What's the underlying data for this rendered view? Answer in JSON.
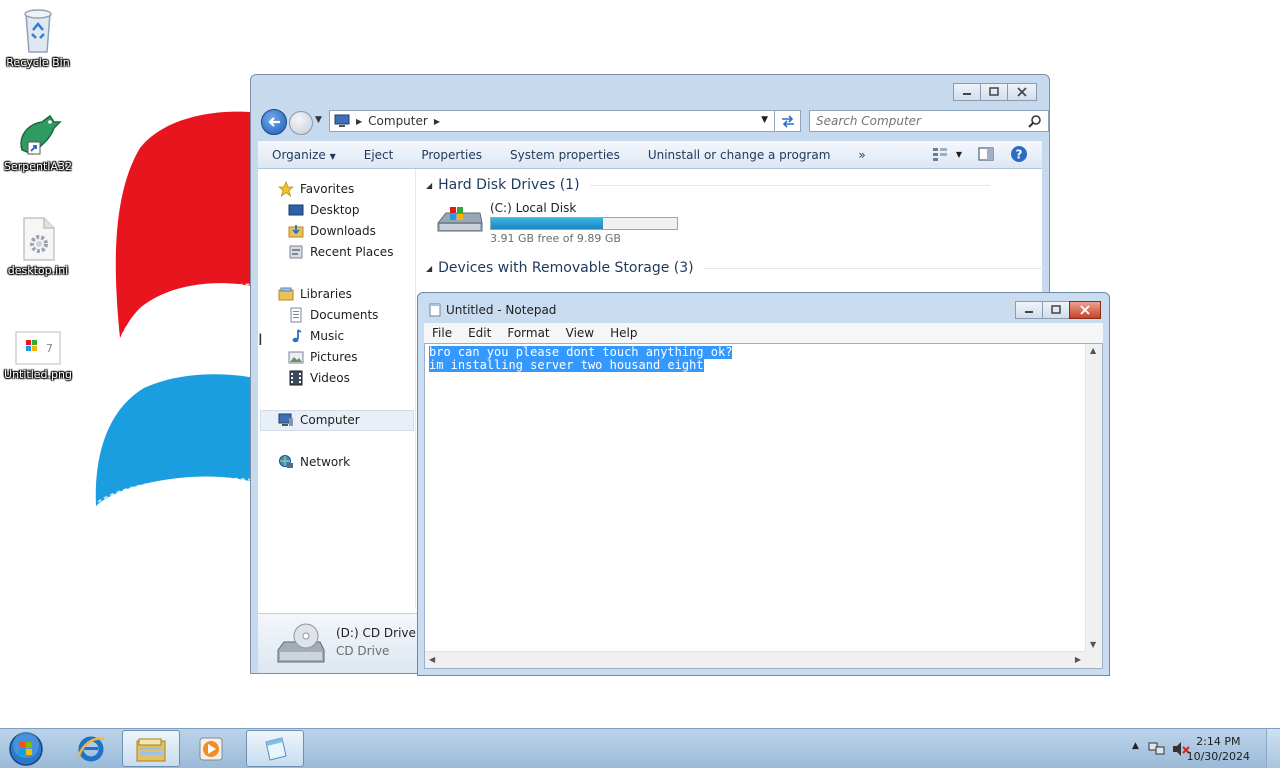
{
  "desktop": {
    "icons": [
      {
        "label": "Recycle Bin",
        "icon": "recycle-bin-icon"
      },
      {
        "label": "SerpentIA32",
        "icon": "serpent-dragon-icon"
      },
      {
        "label": "desktop.ini",
        "icon": "settings-file-icon"
      },
      {
        "label": "Untitled.png",
        "icon": "image-file-icon"
      }
    ]
  },
  "explorer": {
    "address": {
      "crumb": "Computer"
    },
    "search": {
      "placeholder": "Search Computer"
    },
    "toolbar": {
      "organize": "Organize",
      "eject": "Eject",
      "properties": "Properties",
      "system_properties": "System properties",
      "uninstall": "Uninstall or change a program",
      "more": "»"
    },
    "nav": {
      "favorites": "Favorites",
      "desktop": "Desktop",
      "downloads": "Downloads",
      "recent_places": "Recent Places",
      "libraries": "Libraries",
      "documents": "Documents",
      "music": "Music",
      "pictures": "Pictures",
      "videos": "Videos",
      "computer": "Computer",
      "network": "Network"
    },
    "groups": {
      "hard_disks": "Hard Disk Drives (1)",
      "removable": "Devices with Removable Storage (3)"
    },
    "drive_c": {
      "name": "(C:) Local Disk",
      "free_text": "3.91 GB free of 9.89 GB",
      "used_fraction": 0.6
    },
    "details": {
      "name": "(D:) CD Drive",
      "type": "CD Drive"
    }
  },
  "notepad": {
    "title": "Untitled - Notepad",
    "menu": {
      "file": "File",
      "edit": "Edit",
      "format": "Format",
      "view": "View",
      "help": "Help"
    },
    "lines": [
      "bro can you please dont touch anything ok?",
      "im installing server two housand eight"
    ]
  },
  "taskbar": {
    "time": "2:14 PM",
    "date": "10/30/2024"
  },
  "colors": {
    "selection": "#3399ff",
    "accent_red": "#e8141e",
    "accent_blue": "#1a9ee0"
  }
}
